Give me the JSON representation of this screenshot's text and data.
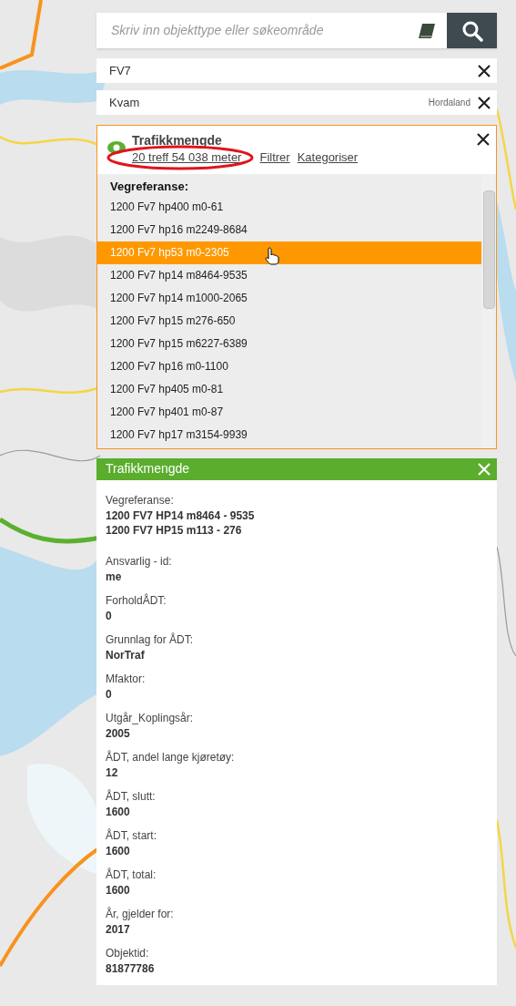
{
  "search": {
    "placeholder": "Skriv inn objekttype eller søkeområde"
  },
  "filters": [
    {
      "label": "FV7"
    },
    {
      "label": "Kvam",
      "region": "Hordaland"
    }
  ],
  "results": {
    "title": "Trafikkmengde",
    "summary": "20 treff 54 038 meter",
    "actions": [
      "Filtrer",
      "Kategoriser"
    ],
    "list_heading": "Vegreferanse:",
    "items": [
      {
        "label": "1200 Fv7 hp400 m0-61",
        "selected": false
      },
      {
        "label": "1200 Fv7 hp16 m2249-8684",
        "selected": false
      },
      {
        "label": "1200 Fv7 hp53 m0-2305",
        "selected": true
      },
      {
        "label": "1200 Fv7 hp14 m8464-9535",
        "selected": false
      },
      {
        "label": "1200 Fv7 hp14 m1000-2065",
        "selected": false
      },
      {
        "label": "1200 Fv7 hp15 m276-650",
        "selected": false
      },
      {
        "label": "1200 Fv7 hp15 m6227-6389",
        "selected": false
      },
      {
        "label": "1200 Fv7 hp16 m0-1100",
        "selected": false
      },
      {
        "label": "1200 Fv7 hp405 m0-81",
        "selected": false
      },
      {
        "label": "1200 Fv7 hp401 m0-87",
        "selected": false
      },
      {
        "label": "1200 Fv7 hp17 m3154-9939",
        "selected": false
      }
    ]
  },
  "details": {
    "title": "Trafikkmengde",
    "fields": [
      {
        "label": "Vegreferanse:",
        "values": [
          "1200 FV7 HP14 m8464 - 9535",
          "1200 FV7 HP15 m113 - 276"
        ]
      },
      {
        "label": "Ansvarlig - id:",
        "values": [
          "me"
        ]
      },
      {
        "label": "ForholdÅDT:",
        "values": [
          "0"
        ]
      },
      {
        "label": "Grunnlag for ÅDT:",
        "values": [
          "NorTraf"
        ]
      },
      {
        "label": "Mfaktor:",
        "values": [
          "0"
        ]
      },
      {
        "label": "Utgår_Koplingsår:",
        "values": [
          "2005"
        ]
      },
      {
        "label": "ÅDT, andel lange kjøretøy:",
        "values": [
          "12"
        ]
      },
      {
        "label": "ÅDT, slutt:",
        "values": [
          "1600"
        ]
      },
      {
        "label": "ÅDT, start:",
        "values": [
          "1600"
        ]
      },
      {
        "label": "ÅDT, total:",
        "values": [
          "1600"
        ]
      },
      {
        "label": "År, gjelder for:",
        "values": [
          "2017"
        ]
      },
      {
        "label": "Objektid:",
        "values": [
          "81877786"
        ]
      }
    ]
  }
}
